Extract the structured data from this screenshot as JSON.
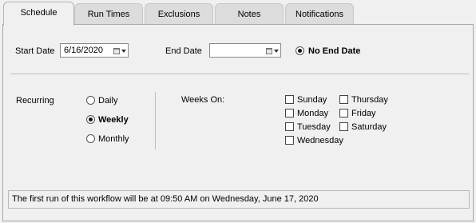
{
  "tabs": [
    {
      "label": "Schedule",
      "active": true
    },
    {
      "label": "Run Times",
      "active": false
    },
    {
      "label": "Exclusions",
      "active": false
    },
    {
      "label": "Notes",
      "active": false
    },
    {
      "label": "Notifications",
      "active": false
    }
  ],
  "dates": {
    "start_label": "Start Date",
    "start_value": "6/16/2020",
    "end_label": "End Date",
    "end_value": "",
    "no_end_label": "No End Date",
    "no_end_selected": true,
    "icon": "calendar-icon"
  },
  "recurring": {
    "label": "Recurring",
    "options": [
      {
        "label": "Daily",
        "selected": false
      },
      {
        "label": "Weekly",
        "selected": true
      },
      {
        "label": "Monthly",
        "selected": false
      }
    ]
  },
  "weeks": {
    "label": "Weeks On:",
    "days": [
      {
        "label": "Sunday",
        "checked": false
      },
      {
        "label": "Monday",
        "checked": false
      },
      {
        "label": "Tuesday",
        "checked": false
      },
      {
        "label": "Wednesday",
        "checked": false
      },
      {
        "label": "Thursday",
        "checked": false
      },
      {
        "label": "Friday",
        "checked": false
      },
      {
        "label": "Saturday",
        "checked": false
      }
    ]
  },
  "status": {
    "text": "The first run of this workflow will be at 09:50 AM on Wednesday, June 17, 2020"
  }
}
